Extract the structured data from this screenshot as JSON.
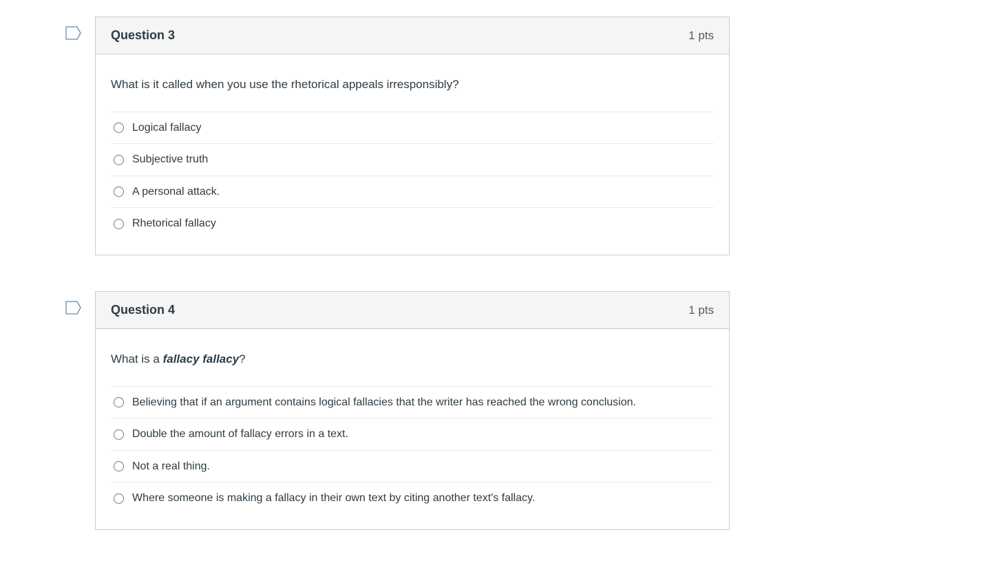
{
  "questions": [
    {
      "title": "Question 3",
      "points": "1 pts",
      "prompt_plain": "What is it called when you use the rhetorical appeals irresponsibly?",
      "prompt_emph": "",
      "prompt_after": "",
      "options": [
        "Logical fallacy",
        "Subjective truth",
        "A personal attack.",
        "Rhetorical fallacy"
      ]
    },
    {
      "title": "Question 4",
      "points": "1 pts",
      "prompt_plain": "What is a ",
      "prompt_emph": "fallacy fallacy",
      "prompt_after": "?",
      "options": [
        "Believing that if an argument contains logical fallacies that the writer has reached the wrong conclusion.",
        "Double the amount of fallacy errors in a text.",
        "Not a real thing.",
        "Where someone is making a fallacy in their own text by citing another text's fallacy."
      ]
    }
  ]
}
